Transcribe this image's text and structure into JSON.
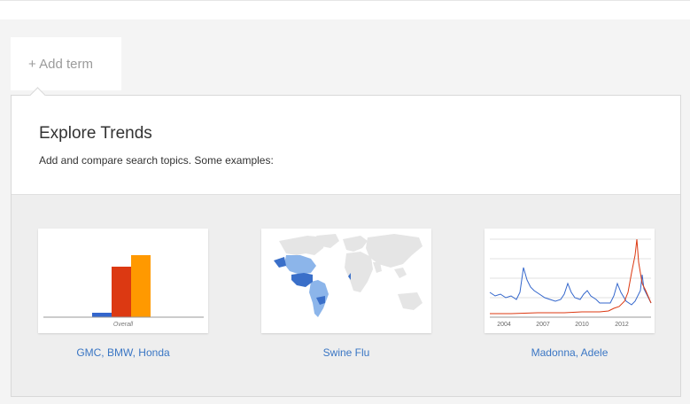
{
  "add_term": {
    "label": "+ Add term"
  },
  "panel": {
    "title": "Explore Trends",
    "subtitle": "Add and compare search topics. Some examples:"
  },
  "examples": [
    {
      "label": "GMC, BMW, Honda",
      "thumbnail": "bar-chart",
      "axis_label": "Overall",
      "bars": [
        {
          "value": 5,
          "color": "#3366cc"
        },
        {
          "value": 57,
          "color": "#dc3912"
        },
        {
          "value": 70,
          "color": "#ff9900"
        }
      ]
    },
    {
      "label": "Swine Flu",
      "thumbnail": "world-map",
      "colors": {
        "high": "#3a6fc9",
        "mid": "#8cb5ea",
        "low": "#e5e5e5"
      }
    },
    {
      "label": "Madonna, Adele",
      "thumbnail": "line-chart",
      "x_ticks": [
        "2004",
        "2007",
        "2010",
        "2012"
      ],
      "series_colors": [
        "#3366cc",
        "#dc3912"
      ]
    }
  ]
}
